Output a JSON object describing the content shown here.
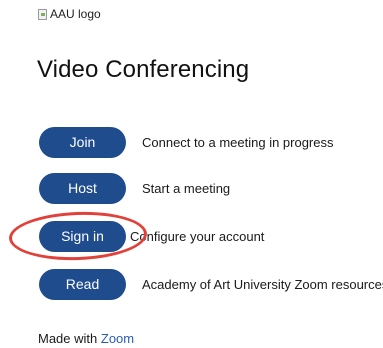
{
  "logo": {
    "alt_text": "AAU logo",
    "icon": "broken-image-icon"
  },
  "page": {
    "title": "Video Conferencing"
  },
  "actions": [
    {
      "button": "Join",
      "description": "Connect to a meeting in progress"
    },
    {
      "button": "Host",
      "description": "Start a meeting"
    },
    {
      "button": "Sign in",
      "description": "Configure your account"
    },
    {
      "button": "Read",
      "description": "Academy of Art University Zoom resources"
    }
  ],
  "annotation": {
    "highlighted_action": "Sign in",
    "color": "#e0413a"
  },
  "footer": {
    "made_with": "Made with",
    "link": "Zoom"
  },
  "colors": {
    "button_bg": "#1e4c8d",
    "button_text": "#ffffff",
    "link": "#2a5db0"
  }
}
